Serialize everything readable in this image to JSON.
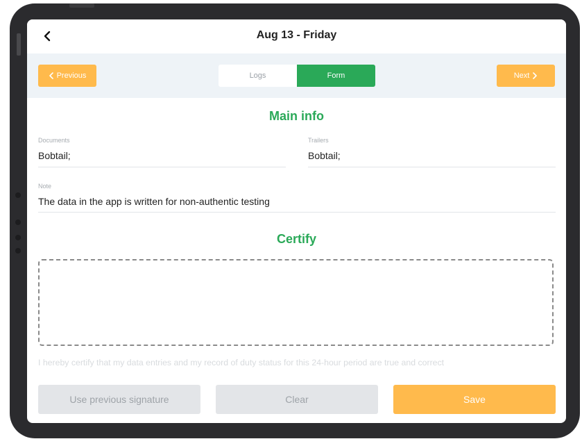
{
  "header": {
    "title": "Aug 13 - Friday"
  },
  "nav": {
    "previous_label": "Previous",
    "next_label": "Next",
    "tabs": [
      {
        "label": "Logs",
        "active": false
      },
      {
        "label": "Form",
        "active": true
      }
    ]
  },
  "main_info": {
    "title": "Main info",
    "documents": {
      "label": "Documents",
      "value": "Bobtail;"
    },
    "trailers": {
      "label": "Trailers",
      "value": "Bobtail;"
    },
    "note": {
      "label": "Note",
      "value": "The data in the app is written for non-authentic testing"
    }
  },
  "certify": {
    "title": "Certify",
    "statement": "I hereby certify that my data entries and my record of duty status for this 24-hour period are true and correct"
  },
  "actions": {
    "use_previous_label": "Use previous signature",
    "clear_label": "Clear",
    "save_label": "Save"
  },
  "colors": {
    "accent_orange": "#ffba4c",
    "accent_green": "#2aa958",
    "nav_background": "#eef3f7",
    "disabled_button": "#e3e5e8"
  },
  "icons": {
    "back": "chevron-left-icon",
    "previous": "chevron-left-icon",
    "next": "chevron-right-icon"
  }
}
